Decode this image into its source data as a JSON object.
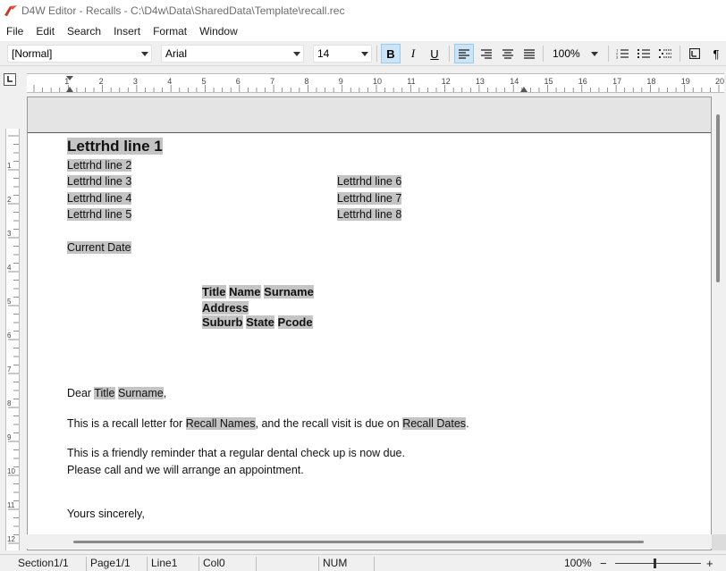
{
  "window": {
    "title": "D4W Editor - Recalls - C:\\D4w\\Data\\SharedData\\Template\\recall.rec"
  },
  "menu": [
    "File",
    "Edit",
    "Search",
    "Insert",
    "Format",
    "Window"
  ],
  "toolbar": {
    "style_value": "[Normal]",
    "font_value": "Arial",
    "size_value": "14",
    "zoom_value": "100%",
    "bold_label": "B",
    "italic_label": "I",
    "underline_label": "U"
  },
  "ruler": {
    "numbers": [
      "1",
      "2",
      "3",
      "4",
      "5",
      "6",
      "7",
      "8",
      "9",
      "10",
      "11",
      "12",
      "13",
      "14",
      "15",
      "16",
      "17",
      "18",
      "19",
      "20"
    ],
    "v_numbers": [
      "1",
      "2",
      "3",
      "4",
      "5",
      "6",
      "7",
      "8",
      "9",
      "10",
      "11",
      "12"
    ]
  },
  "document": {
    "letterhead": {
      "line1": "Lettrhd line 1",
      "line2": "Lettrhd line 2",
      "line3": "Lettrhd line 3",
      "line4": "Lettrhd line 4",
      "line5": "Lettrhd line 5",
      "line6": "Lettrhd line 6",
      "line7": "Lettrhd line 7",
      "line8": "Lettrhd line 8"
    },
    "current_date": "Current Date",
    "address": {
      "title": "Title",
      "name": "Name",
      "surname": "Surname",
      "address": "Address",
      "suburb": "Suburb",
      "state": "State",
      "pcode": "Pcode"
    },
    "greeting": {
      "dear": "Dear ",
      "title": "Title",
      "space": " ",
      "surname": "Surname",
      "comma": ","
    },
    "para1": {
      "pre": "This is a recall letter for ",
      "names": "Recall Names",
      "mid": ", and the recall visit is due on ",
      "dates": "Recall Dates",
      "end": "."
    },
    "para2_line1": "This is a friendly reminder that a regular dental check up is now due.",
    "para2_line2": "Please call and we will arrange an appointment.",
    "closing": "Yours sincerely,"
  },
  "status": {
    "section": "Section1/1",
    "page": "Page1/1",
    "line": "Line1",
    "col": "Col0",
    "num": "NUM",
    "zoom": "100%",
    "minus": "−",
    "plus": "+"
  }
}
